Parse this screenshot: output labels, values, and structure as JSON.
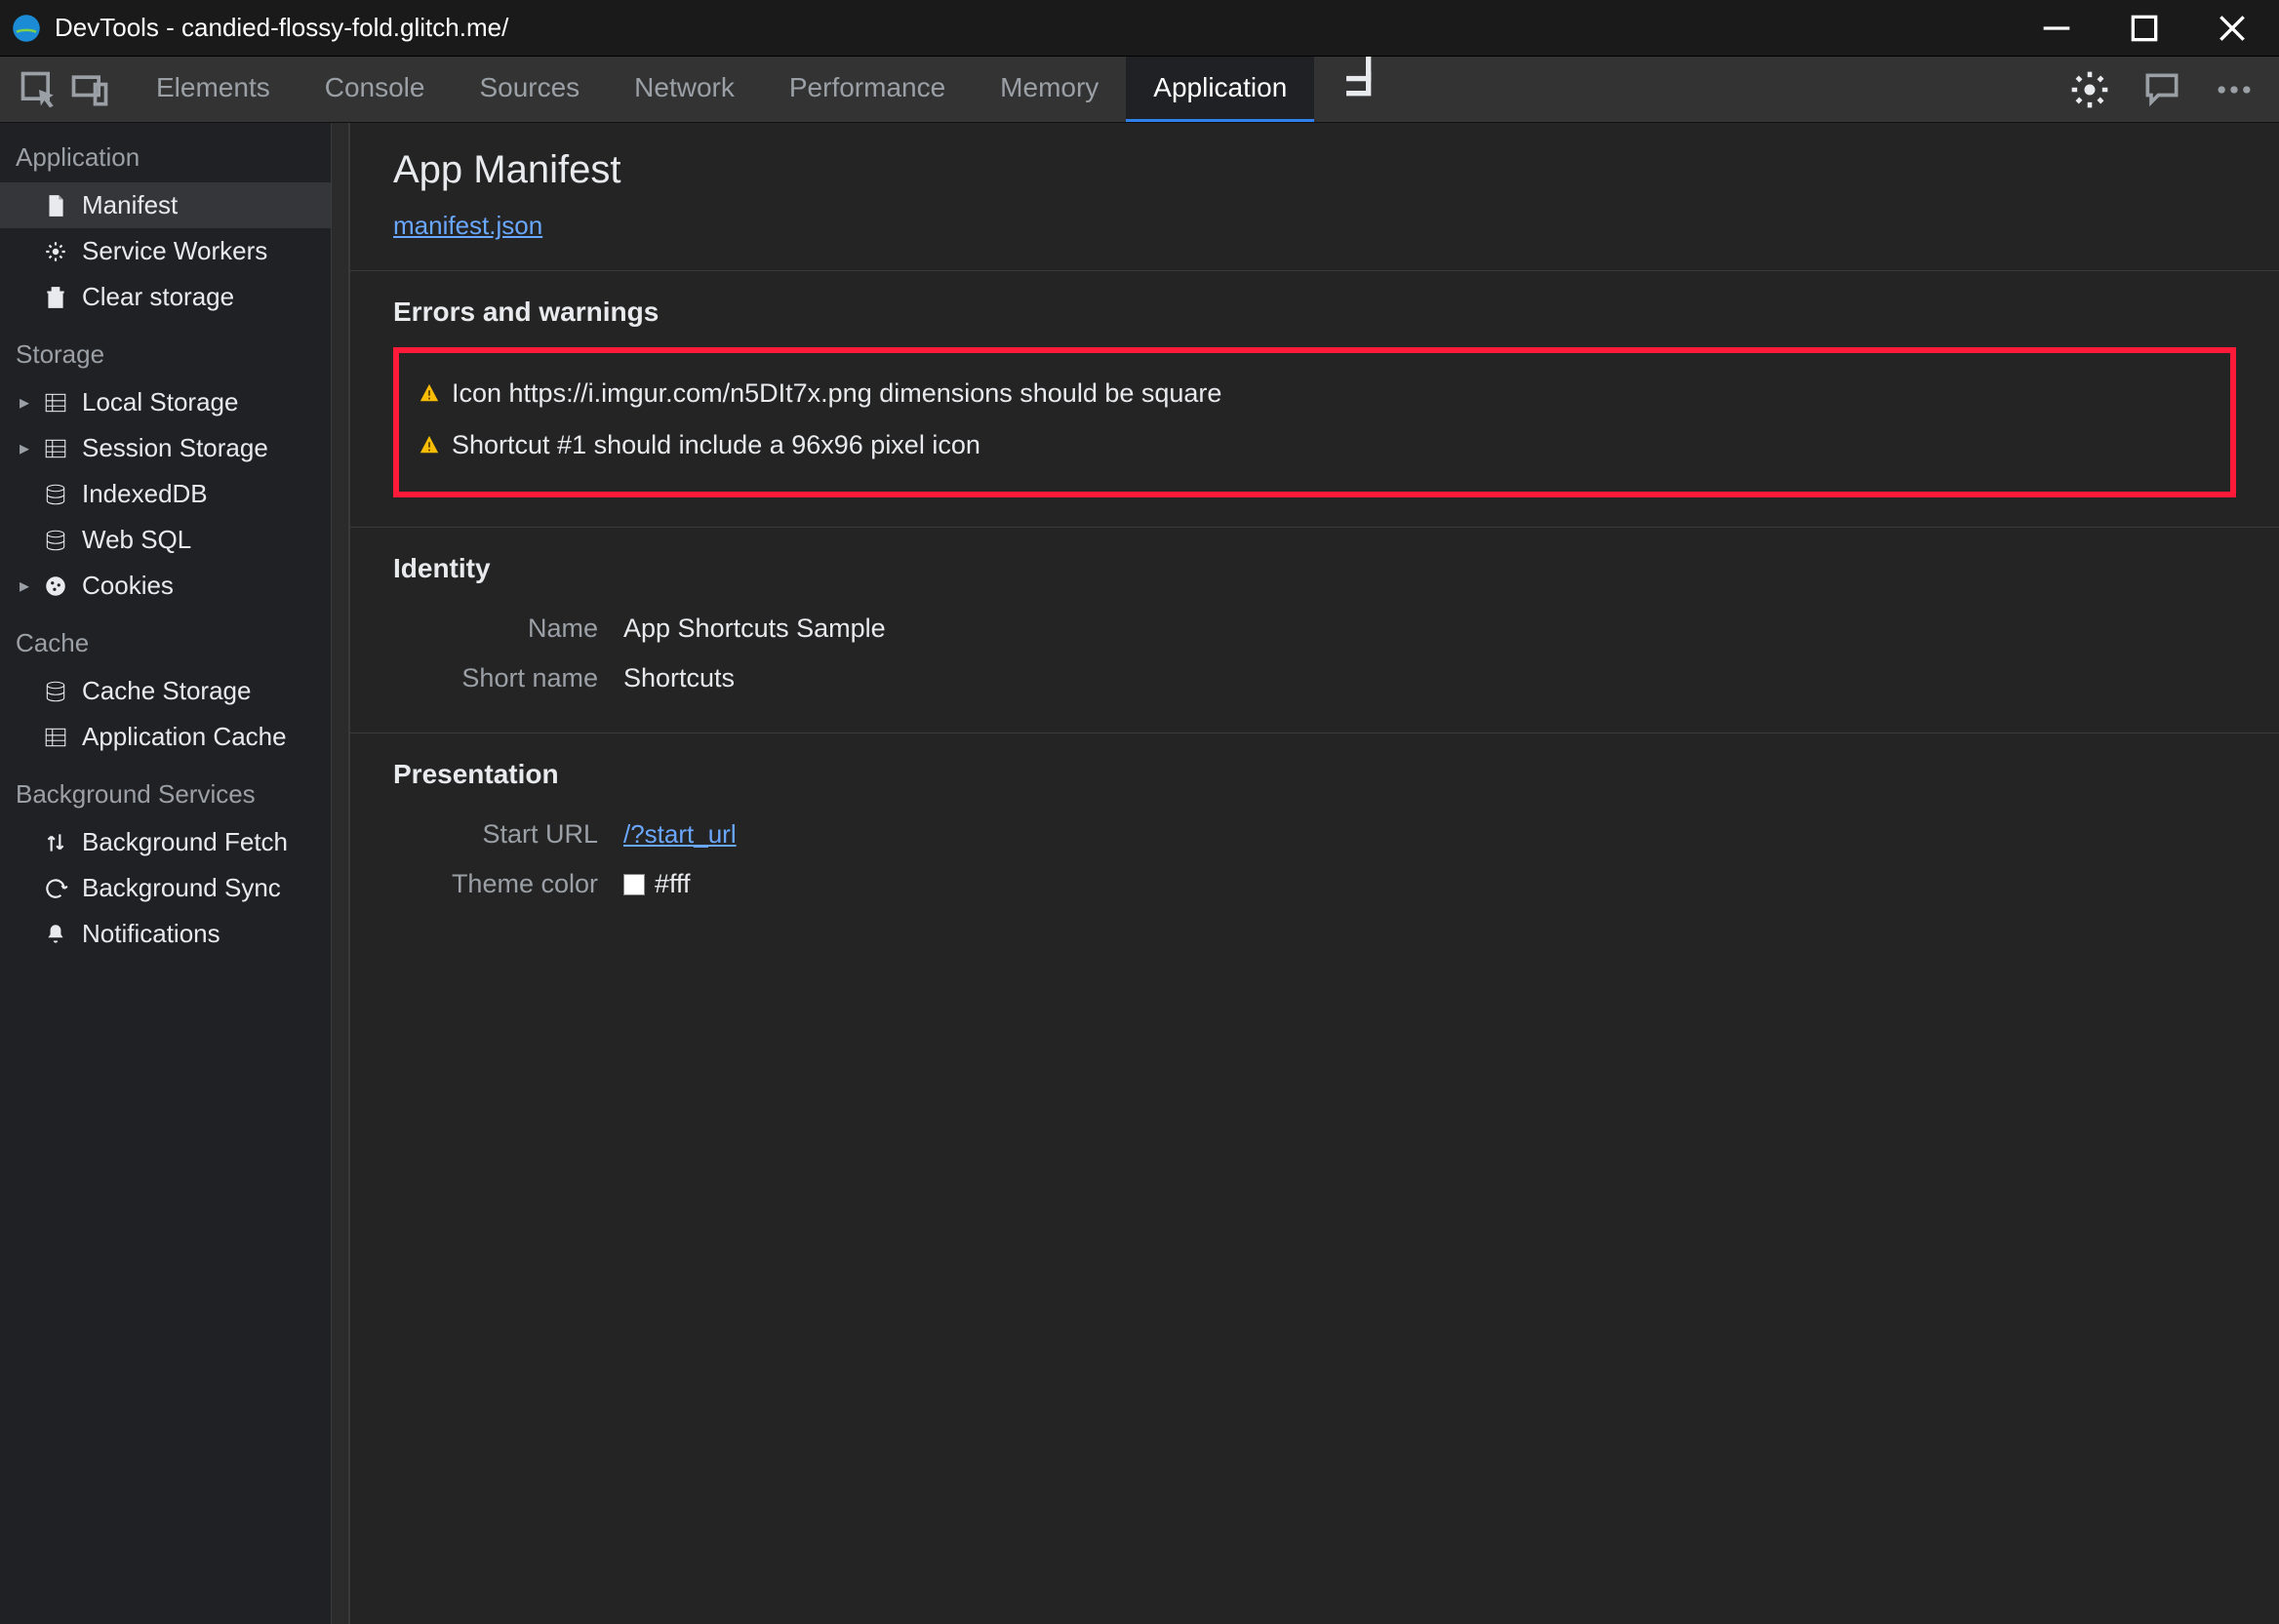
{
  "window": {
    "title": "DevTools - candied-flossy-fold.glitch.me/"
  },
  "tabs": {
    "items": [
      "Elements",
      "Console",
      "Sources",
      "Network",
      "Performance",
      "Memory",
      "Application"
    ],
    "active": "Application"
  },
  "sidebar": {
    "groups": [
      {
        "title": "Application",
        "items": [
          {
            "icon": "document-icon",
            "label": "Manifest",
            "active": true
          },
          {
            "icon": "gear-icon",
            "label": "Service Workers"
          },
          {
            "icon": "trash-icon",
            "label": "Clear storage"
          }
        ]
      },
      {
        "title": "Storage",
        "items": [
          {
            "icon": "grid-icon",
            "label": "Local Storage",
            "expandable": true
          },
          {
            "icon": "grid-icon",
            "label": "Session Storage",
            "expandable": true
          },
          {
            "icon": "database-icon",
            "label": "IndexedDB"
          },
          {
            "icon": "database-icon",
            "label": "Web SQL"
          },
          {
            "icon": "cookie-icon",
            "label": "Cookies",
            "expandable": true
          }
        ]
      },
      {
        "title": "Cache",
        "items": [
          {
            "icon": "database-icon",
            "label": "Cache Storage"
          },
          {
            "icon": "grid-icon",
            "label": "Application Cache"
          }
        ]
      },
      {
        "title": "Background Services",
        "items": [
          {
            "icon": "arrows-vert-icon",
            "label": "Background Fetch"
          },
          {
            "icon": "sync-icon",
            "label": "Background Sync"
          },
          {
            "icon": "bell-icon",
            "label": "Notifications"
          }
        ]
      }
    ]
  },
  "manifest": {
    "page_title": "App Manifest",
    "file_link": "manifest.json",
    "errors_heading": "Errors and warnings",
    "warnings": [
      "Icon https://i.imgur.com/n5DIt7x.png dimensions should be square",
      "Shortcut #1 should include a 96x96 pixel icon"
    ],
    "identity_heading": "Identity",
    "identity": {
      "name_label": "Name",
      "name_value": "App Shortcuts Sample",
      "short_name_label": "Short name",
      "short_name_value": "Shortcuts"
    },
    "presentation_heading": "Presentation",
    "presentation": {
      "start_url_label": "Start URL",
      "start_url_value": "/?start_url",
      "theme_color_label": "Theme color",
      "theme_color_value": "#fff",
      "theme_color_swatch": "#ffffff"
    }
  }
}
